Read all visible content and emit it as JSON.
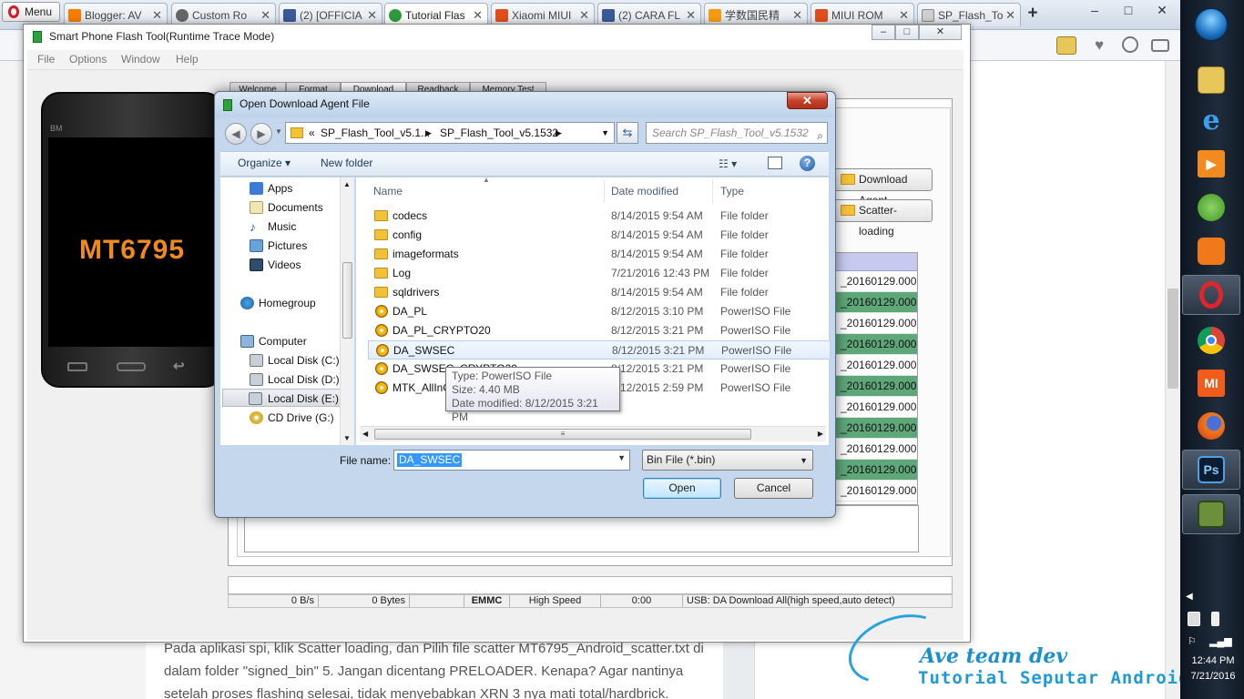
{
  "browser": {
    "menu_label": "Menu",
    "tabs": [
      {
        "label": "Blogger: AV",
        "color": "#f57d00"
      },
      {
        "label": "Custom Ro",
        "color": "#666666"
      },
      {
        "label": "(2) [OFFICIA",
        "color": "#3b5998"
      },
      {
        "label": "Tutorial Flas",
        "color": "#2e9b3a"
      },
      {
        "label": "Xiaomi MIUI",
        "color": "#e04e1b"
      },
      {
        "label": "(2) CARA FL",
        "color": "#3b5998"
      },
      {
        "label": "学数国民精",
        "color": "#f39c12"
      },
      {
        "label": "MIUI ROM",
        "color": "#e04e1b"
      },
      {
        "label": "SP_Flash_To",
        "color": "#888888"
      }
    ],
    "new_tab": "+",
    "win_min": "–",
    "win_max": "□",
    "win_close": "✕"
  },
  "article": {
    "text": "Pada aplikasi spi, klik Scatter loading, dan Pilih file scatter MT6795_Android_scatter.txt di dalam folder \"signed_bin\" 5. Jangan dicentang PRELOADER. Kenapa? Agar nantinya setelah proses flashing selesai, tidak menyebabkan XRN 3 nya mati total/hardbrick."
  },
  "flashtool": {
    "title": "Smart Phone Flash Tool(Runtime Trace Mode)",
    "menu": [
      "File",
      "Options",
      "Window",
      "Help"
    ],
    "tabs": [
      "Welcome",
      "Format",
      "Download",
      "Readback",
      "Memory Test"
    ],
    "phone_brand": "BM",
    "phone_model": "MT6795",
    "download_agent_btn": "Download Agent",
    "scatter_btn": "Scatter-loading",
    "list_rows": [
      "_20160129.000...",
      "_20160129.000...",
      "_20160129.000...",
      "_20160129.000...",
      "_20160129.000...",
      "_20160129.000...",
      "_20160129.000...",
      "_20160129.000...",
      "_20160129.000...",
      "_20160129.000...",
      "_20160129.000..."
    ],
    "status": {
      "speed": "0 B/s",
      "bytes": "0 Bytes",
      "storage": "EMMC",
      "mode": "High Speed",
      "time": "0:00",
      "usb": "USB: DA Download All(high speed,auto detect)"
    }
  },
  "dialog": {
    "title": "Open Download Agent File",
    "close": "✕",
    "breadcrumb": [
      "«",
      "SP_Flash_Tool_v5.1...",
      "SP_Flash_Tool_v5.1532"
    ],
    "search_placeholder": "Search SP_Flash_Tool_v5.1532",
    "organize": "Organize ▾",
    "new_folder": "New folder",
    "nav": {
      "apps": "Apps",
      "documents": "Documents",
      "music": "Music",
      "pictures": "Pictures",
      "videos": "Videos",
      "homegroup": "Homegroup",
      "computer": "Computer",
      "drive_c": "Local Disk (C:)",
      "drive_d": "Local Disk (D:)",
      "drive_e": "Local Disk (E:)",
      "drive_g": "CD Drive (G:)"
    },
    "columns": {
      "name": "Name",
      "date": "Date modified",
      "type": "Type"
    },
    "files": [
      {
        "name": "codecs",
        "date": "8/14/2015 9:54 AM",
        "type": "File folder"
      },
      {
        "name": "config",
        "date": "8/14/2015 9:54 AM",
        "type": "File folder"
      },
      {
        "name": "imageformats",
        "date": "8/14/2015 9:54 AM",
        "type": "File folder"
      },
      {
        "name": "Log",
        "date": "7/21/2016 12:43 PM",
        "type": "File folder"
      },
      {
        "name": "sqldrivers",
        "date": "8/14/2015 9:54 AM",
        "type": "File folder"
      },
      {
        "name": "DA_PL",
        "date": "8/12/2015 3:10 PM",
        "type": "PowerISO File"
      },
      {
        "name": "DA_PL_CRYPTO20",
        "date": "8/12/2015 3:21 PM",
        "type": "PowerISO File"
      },
      {
        "name": "DA_SWSEC",
        "date": "8/12/2015 3:21 PM",
        "type": "PowerISO File"
      },
      {
        "name": "DA_SWSEC_CRYPTO20",
        "date": "8/12/2015 3:21 PM",
        "type": "PowerISO File"
      },
      {
        "name": "MTK_AllInOne_DA",
        "date": "8/12/2015 2:59 PM",
        "type": "PowerISO File"
      }
    ],
    "tooltip": {
      "type": "Type: PowerISO File",
      "size": "Size: 4.40 MB",
      "date": "Date modified: 8/12/2015 3:21 PM"
    },
    "file_name_label": "File name:",
    "file_name_value": "DA_SWSEC",
    "file_type": "Bin File (*.bin)",
    "open": "Open",
    "cancel": "Cancel"
  },
  "taskbar": {
    "time": "12:44 PM",
    "date": "7/21/2016",
    "mi_label": "MI",
    "ps_label": "Ps"
  },
  "watermark": {
    "line1": "Ave team dev",
    "line2": "Tutorial Seputar Android"
  }
}
